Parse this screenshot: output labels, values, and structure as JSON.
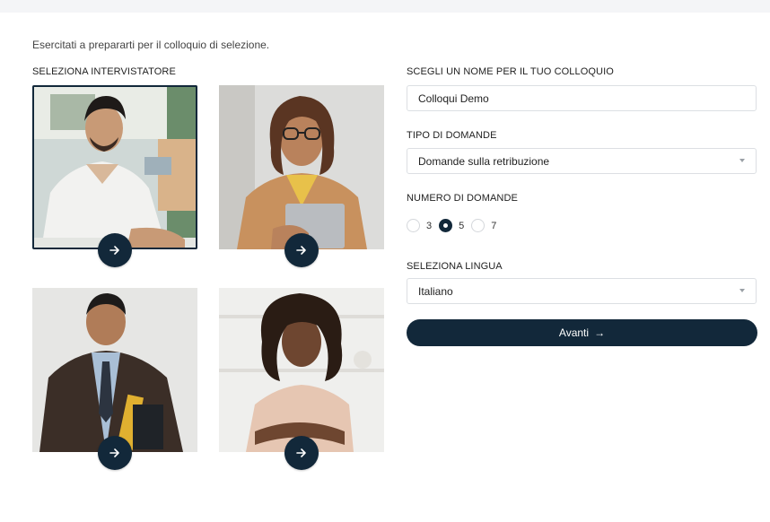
{
  "intro_text": "Esercitati a prepararti per il colloquio di selezione.",
  "interviewers": {
    "label": "SELEZIONA INTERVISTATORE",
    "selected_index": 0,
    "cards": [
      {
        "name": "interviewer-1",
        "icon": "arrow-right-icon"
      },
      {
        "name": "interviewer-2",
        "icon": "arrow-right-icon"
      },
      {
        "name": "interviewer-3",
        "icon": "arrow-right-icon"
      },
      {
        "name": "interviewer-4",
        "icon": "arrow-right-icon"
      }
    ]
  },
  "form": {
    "name_label": "SCEGLI UN NOME PER IL TUO COLLOQUIO",
    "name_value": "Colloqui Demo",
    "question_type_label": "TIPO DI DOMANDE",
    "question_type_value": "Domande sulla retribuzione",
    "question_count_label": "NUMERO DI DOMANDE",
    "question_count_options": [
      "3",
      "5",
      "7"
    ],
    "question_count_selected": "5",
    "language_label": "SELEZIONA LINGUA",
    "language_value": "Italiano",
    "next_label": "Avanti",
    "next_icon": "→"
  },
  "colors": {
    "primary": "#12283a",
    "border": "#dcdfe3"
  }
}
